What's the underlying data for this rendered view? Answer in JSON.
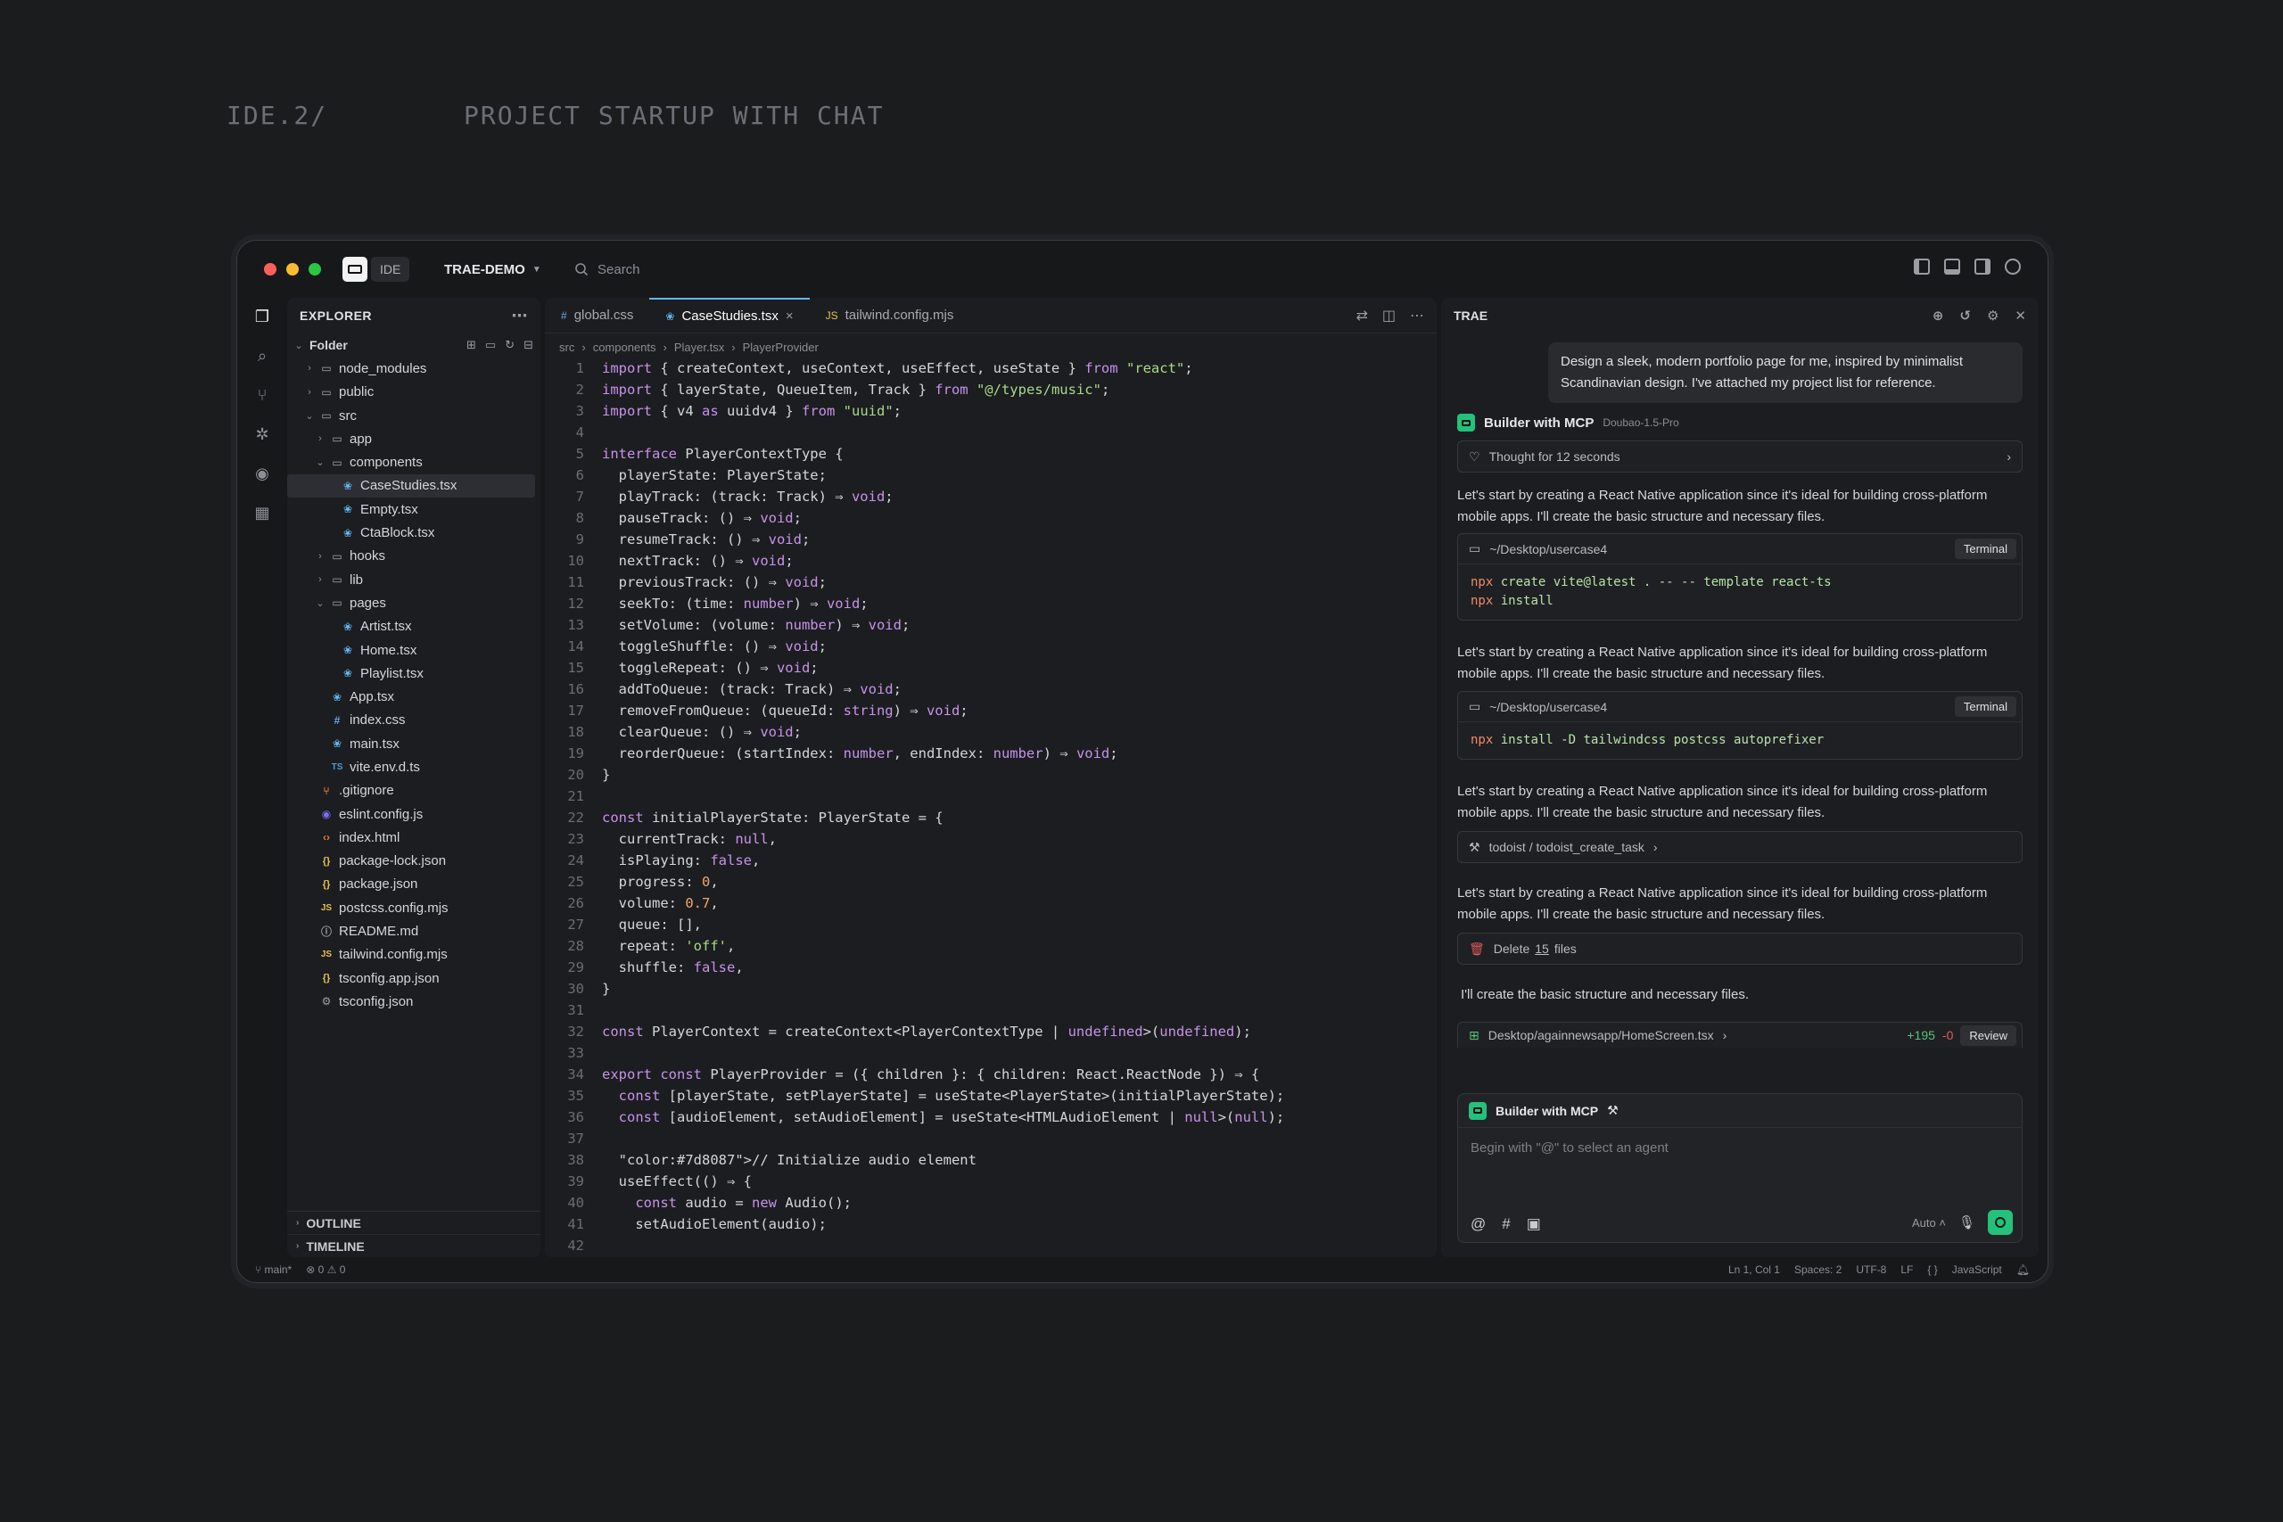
{
  "page": {
    "label_left": "IDE.2/",
    "label_right": "PROJECT STARTUP WITH CHAT"
  },
  "titlebar": {
    "badge": "IDE",
    "project": "TRAE-DEMO",
    "search_placeholder": "Search"
  },
  "explorer": {
    "title": "EXPLORER",
    "root": "Folder",
    "items": [
      {
        "name": "node_modules",
        "depth": 1,
        "type": "folder",
        "open": false
      },
      {
        "name": "public",
        "depth": 1,
        "type": "folder",
        "open": false
      },
      {
        "name": "src",
        "depth": 1,
        "type": "folder",
        "open": true
      },
      {
        "name": "app",
        "depth": 2,
        "type": "folder",
        "open": false
      },
      {
        "name": "components",
        "depth": 2,
        "type": "folder",
        "open": true
      },
      {
        "name": "CaseStudies.tsx",
        "depth": 3,
        "type": "react",
        "selected": true
      },
      {
        "name": "Empty.tsx",
        "depth": 3,
        "type": "react"
      },
      {
        "name": "CtaBlock.tsx",
        "depth": 3,
        "type": "react"
      },
      {
        "name": "hooks",
        "depth": 2,
        "type": "folder",
        "open": false
      },
      {
        "name": "lib",
        "depth": 2,
        "type": "folder",
        "open": false
      },
      {
        "name": "pages",
        "depth": 2,
        "type": "folder",
        "open": true
      },
      {
        "name": "Artist.tsx",
        "depth": 3,
        "type": "react"
      },
      {
        "name": "Home.tsx",
        "depth": 3,
        "type": "react"
      },
      {
        "name": "Playlist.tsx",
        "depth": 3,
        "type": "react"
      },
      {
        "name": "App.tsx",
        "depth": 2,
        "type": "react"
      },
      {
        "name": "index.css",
        "depth": 2,
        "type": "css"
      },
      {
        "name": "main.tsx",
        "depth": 2,
        "type": "react"
      },
      {
        "name": "vite.env.d.ts",
        "depth": 2,
        "type": "ts"
      },
      {
        "name": ".gitignore",
        "depth": 1,
        "type": "git"
      },
      {
        "name": "eslint.config.js",
        "depth": 1,
        "type": "eslint"
      },
      {
        "name": "index.html",
        "depth": 1,
        "type": "html"
      },
      {
        "name": "package-lock.json",
        "depth": 1,
        "type": "json"
      },
      {
        "name": "package.json",
        "depth": 1,
        "type": "json"
      },
      {
        "name": "postcss.config.mjs",
        "depth": 1,
        "type": "js"
      },
      {
        "name": "README.md",
        "depth": 1,
        "type": "info"
      },
      {
        "name": "tailwind.config.mjs",
        "depth": 1,
        "type": "js"
      },
      {
        "name": "tsconfig.app.json",
        "depth": 1,
        "type": "json"
      },
      {
        "name": "tsconfig.json",
        "depth": 1,
        "type": "gear"
      }
    ],
    "outline": "OUTLINE",
    "timeline": "TIMELINE"
  },
  "editor": {
    "tabs": [
      {
        "label": "global.css",
        "icon": "#",
        "active": false
      },
      {
        "label": "CaseStudies.tsx",
        "icon": "❀",
        "active": true
      },
      {
        "label": "tailwind.config.mjs",
        "icon": "JS",
        "active": false
      }
    ],
    "breadcrumb": [
      "src",
      "components",
      "Player.tsx",
      "PlayerProvider"
    ],
    "lines": [
      "import { createContext, useContext, useEffect, useState } from \"react\";",
      "import { layerState, QueueItem, Track } from \"@/types/music\";",
      "import { v4 as uuidv4 } from \"uuid\";",
      "",
      "interface PlayerContextType {",
      "  playerState: PlayerState;",
      "  playTrack: (track: Track) ⇒ void;",
      "  pauseTrack: () ⇒ void;",
      "  resumeTrack: () ⇒ void;",
      "  nextTrack: () ⇒ void;",
      "  previousTrack: () ⇒ void;",
      "  seekTo: (time: number) ⇒ void;",
      "  setVolume: (volume: number) ⇒ void;",
      "  toggleShuffle: () ⇒ void;",
      "  toggleRepeat: () ⇒ void;",
      "  addToQueue: (track: Track) ⇒ void;",
      "  removeFromQueue: (queueId: string) ⇒ void;",
      "  clearQueue: () ⇒ void;",
      "  reorderQueue: (startIndex: number, endIndex: number) ⇒ void;",
      "}",
      "",
      "const initialPlayerState: PlayerState = {",
      "  currentTrack: null,",
      "  isPlaying: false,",
      "  progress: 0,",
      "  volume: 0.7,",
      "  queue: [],",
      "  repeat: 'off',",
      "  shuffle: false,",
      "}",
      "",
      "const PlayerContext = createContext<PlayerContextType | undefined>(undefined);",
      "",
      "export const PlayerProvider = ({ children }: { children: React.ReactNode }) ⇒ {",
      "  const [playerState, setPlayerState] = useState<PlayerState>(initialPlayerState);",
      "  const [audioElement, setAudioElement] = useState<HTMLAudioElement | null>(null);",
      "",
      "  // Initialize audio element",
      "  useEffect(() ⇒ {",
      "    const audio = new Audio();",
      "    setAudioElement(audio);",
      ""
    ]
  },
  "chat": {
    "title": "TRAE",
    "user_message": "Design a sleek, modern portfolio page for me, inspired by minimalist Scandinavian design. I've attached my project list for reference.",
    "agent_name": "Builder with MCP",
    "model": "Doubao-1.5-Pro",
    "thought": "Thought for 12 seconds",
    "paragraph": "Let's start by creating a React Native application since it's ideal for building cross-platform mobile apps. I'll create the basic structure and necessary files.",
    "terminal1": {
      "path": "~/Desktop/usercase4",
      "button": "Terminal",
      "line1_cmd": "npx",
      "line1_rest": " create vite@latest . -- -- template react-ts",
      "line2_cmd": "npx",
      "line2_rest": " install"
    },
    "terminal2": {
      "path": "~/Desktop/usercase4",
      "button": "Terminal",
      "line1_cmd": "npx",
      "line1_rest": " install -D tailwindcss postcss autoprefixer"
    },
    "tool_call": "todoist / todoist_create_task",
    "delete_prefix": "Delete",
    "delete_count": "15",
    "delete_suffix": "files",
    "final_text": "I'll create the basic structure and necessary files.",
    "review": {
      "path": "Desktop/againnewsapp/HomeScreen.tsx",
      "plus": "+195",
      "minus": "-0",
      "button": "Review"
    },
    "composer": {
      "agent": "Builder with MCP",
      "placeholder": "Begin with \"@\" to select an agent",
      "mode": "Auto"
    }
  },
  "statusbar": {
    "branch": "main*",
    "problems": "⊗ 0 ⚠ 0",
    "position": "Ln 1, Col 1",
    "spaces": "Spaces: 2",
    "encoding": "UTF-8",
    "eol": "LF",
    "braces": "{ }",
    "language": "JavaScript"
  }
}
